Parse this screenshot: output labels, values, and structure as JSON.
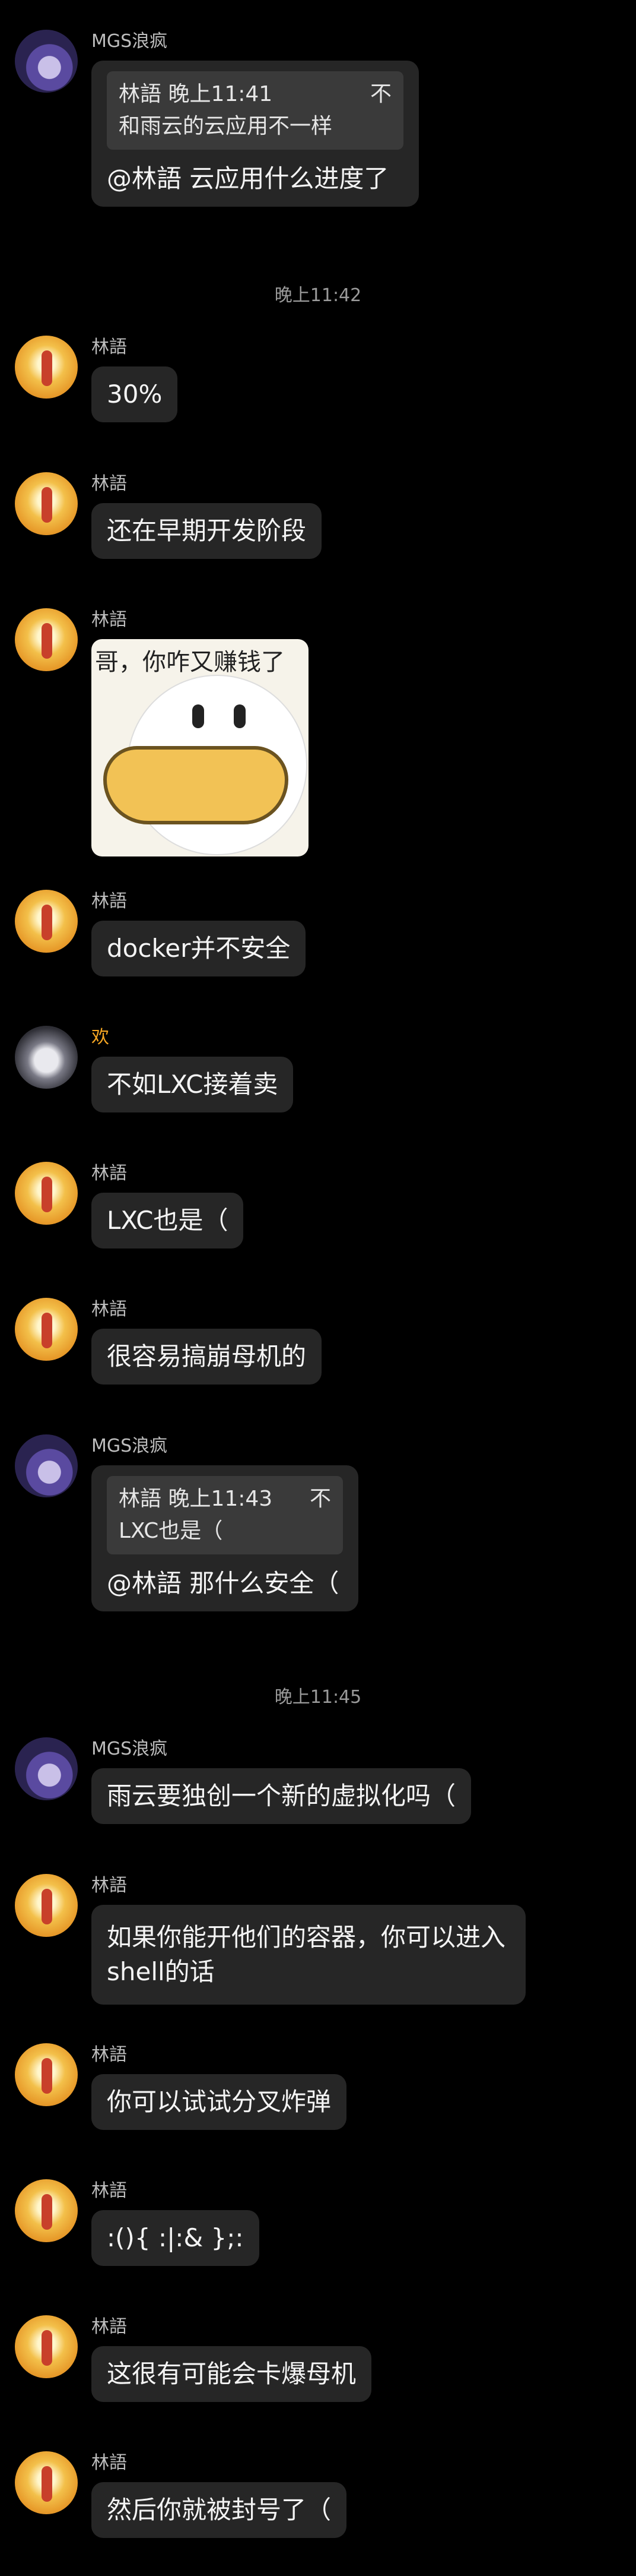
{
  "conversation": [
    {
      "type": "message",
      "sender": "MGS浪疯",
      "avatar": "mgs",
      "quote": {
        "head": "林語 晚上11:41",
        "tail": "不",
        "body": "和雨云的云应用不一样"
      },
      "text": "@林語 云应用什么进度了"
    },
    {
      "type": "time",
      "text": "晚上11:42"
    },
    {
      "type": "message",
      "sender": "林語",
      "avatar": "lin",
      "text": "30%"
    },
    {
      "type": "message",
      "sender": "林語",
      "avatar": "lin",
      "text": "还在早期开发阶段"
    },
    {
      "type": "sticker",
      "sender": "林語",
      "avatar": "lin",
      "caption": "哥，你咋又赚钱了"
    },
    {
      "type": "message",
      "sender": "林語",
      "avatar": "lin",
      "text": "docker并不安全"
    },
    {
      "type": "message",
      "sender": "欢",
      "avatar": "huan",
      "text": "不如LXC接着卖"
    },
    {
      "type": "message",
      "sender": "林語",
      "avatar": "lin",
      "text": "LXC也是（"
    },
    {
      "type": "message",
      "sender": "林語",
      "avatar": "lin",
      "text": "很容易搞崩母机的"
    },
    {
      "type": "message",
      "sender": "MGS浪疯",
      "avatar": "mgs",
      "quote": {
        "head": "林語 晚上11:43",
        "tail": "不",
        "body": "LXC也是（"
      },
      "text": "@林語 那什么安全（"
    },
    {
      "type": "time",
      "text": "晚上11:45"
    },
    {
      "type": "message",
      "sender": "MGS浪疯",
      "avatar": "mgs",
      "text": "雨云要独创一个新的虚拟化吗（"
    },
    {
      "type": "message",
      "sender": "林語",
      "avatar": "lin",
      "text": "如果你能开他们的容器，你可以进入shell的话"
    },
    {
      "type": "message",
      "sender": "林語",
      "avatar": "lin",
      "text": "你可以试试分叉炸弹"
    },
    {
      "type": "message",
      "sender": "林語",
      "avatar": "lin",
      "text": ":(){ :|:& };:"
    },
    {
      "type": "message",
      "sender": "林語",
      "avatar": "lin",
      "text": "这很有可能会卡爆母机"
    },
    {
      "type": "message",
      "sender": "林語",
      "avatar": "lin",
      "text": "然后你就被封号了（"
    }
  ]
}
